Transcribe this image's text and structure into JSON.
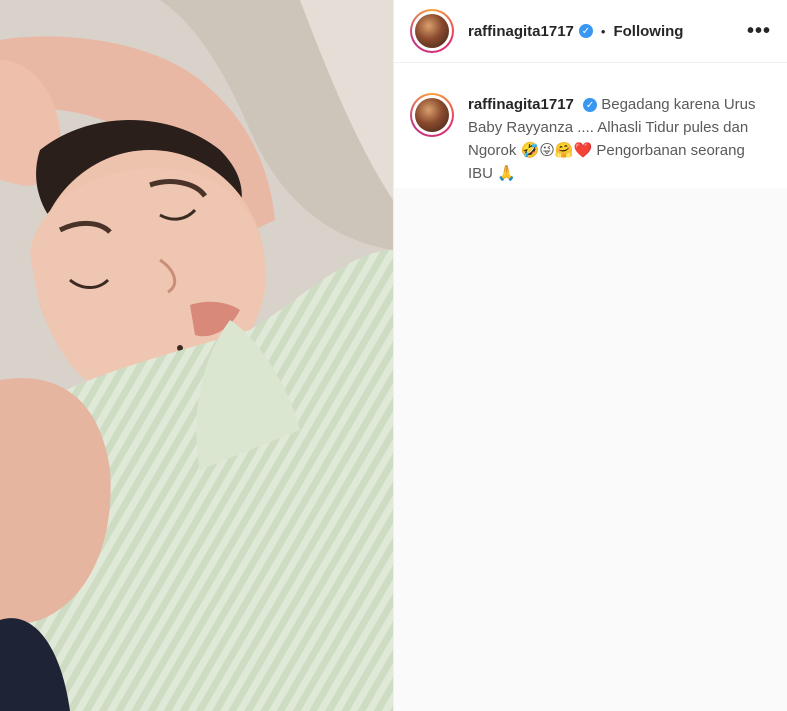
{
  "post": {
    "username": "raffinagita1717",
    "verified_glyph": "✓",
    "separator": "•",
    "follow_label": "Following",
    "more_label": "•••"
  },
  "caption": {
    "username": "raffinagita1717",
    "text": "Begadang karena Urus Baby Rayyanza .... Alhasli Tidur pules dan Ngorok 🤣😜🤗❤️ Pengorbanan seorang IBU 🙏"
  },
  "icons": {
    "verified": "verified-badge-icon",
    "more": "more-options-icon"
  },
  "colors": {
    "accent_verified": "#3897f0",
    "text": "#262626",
    "ring": [
      "#f9a23a",
      "#e1306c",
      "#c13584"
    ]
  }
}
